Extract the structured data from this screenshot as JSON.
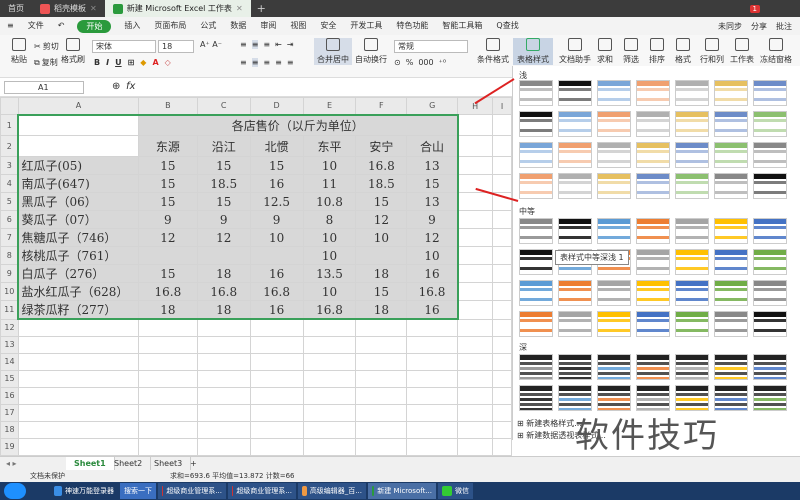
{
  "tabs": {
    "home": "首页",
    "tab1": "稻壳模板",
    "tab2": "新建 Microsoft Excel 工作表",
    "count": "1"
  },
  "menu": {
    "file": "文件",
    "start": "开始",
    "items": [
      "插入",
      "页面布局",
      "公式",
      "数据",
      "审阅",
      "视图",
      "安全",
      "开发工具",
      "特色功能",
      "智能工具箱"
    ],
    "search": "Q查找",
    "sync": "未同步",
    "share": "分享",
    "annotate": "批注"
  },
  "toolbar": {
    "paste": "粘贴",
    "cut": "剪切",
    "copy": "复制",
    "format_painter": "格式刷",
    "font": "宋体",
    "size": "18",
    "merge": "合并居中",
    "wrap": "自动换行",
    "numfmt": "常规",
    "cond": "条件格式",
    "table_style": "表格样式",
    "doc_helper": "文档助手",
    "sum": "求和",
    "filter": "筛选",
    "sort": "排序",
    "format": "格式",
    "rowcol": "行和列",
    "sheet": "工作表",
    "freeze": "冻结窗格"
  },
  "formula": {
    "cell": "A1",
    "fx": "fx"
  },
  "columns": [
    "A",
    "B",
    "C",
    "D",
    "E",
    "F",
    "G",
    "H",
    "I"
  ],
  "sheet": {
    "title": "各店售价（以斤为单位）",
    "stores": [
      "东源",
      "沿江",
      "北惯",
      "东平",
      "安宁",
      "合山"
    ],
    "rows": [
      {
        "name": "红瓜子(05)",
        "v": [
          "15",
          "15",
          "15",
          "10",
          "16.8",
          "13"
        ]
      },
      {
        "name": "南瓜子(647)",
        "v": [
          "15",
          "18.5",
          "16",
          "11",
          "18.5",
          "15"
        ]
      },
      {
        "name": "黑瓜子（06）",
        "v": [
          "15",
          "15",
          "12.5",
          "10.8",
          "15",
          "13"
        ]
      },
      {
        "name": "葵瓜子（07）",
        "v": [
          "9",
          "9",
          "9",
          "8",
          "12",
          "9"
        ]
      },
      {
        "name": "焦糖瓜子（746）",
        "v": [
          "12",
          "12",
          "10",
          "10",
          "10",
          "12"
        ]
      },
      {
        "name": "核桃瓜子（761）",
        "v": [
          "",
          "",
          "",
          "10",
          "",
          "10"
        ]
      },
      {
        "name": "白瓜子（276）",
        "v": [
          "15",
          "18",
          "16",
          "13.5",
          "18",
          "16"
        ]
      },
      {
        "name": "盐水红瓜子（628）",
        "v": [
          "16.8",
          "16.8",
          "16.8",
          "10",
          "15",
          "16.8"
        ]
      },
      {
        "name": "绿茶瓜籽（277）",
        "v": [
          "18",
          "18",
          "16",
          "16.8",
          "18",
          "16"
        ]
      }
    ]
  },
  "panel": {
    "light": "浅",
    "medium": "中等",
    "dark": "深",
    "tooltip": "表样式中等深浅 1",
    "new_table_style": "新建表格样式...",
    "new_data_style": "新建数据透视表样式..."
  },
  "sheets": [
    "Sheet1",
    "Sheet2",
    "Sheet3"
  ],
  "status": {
    "protect": "文档未保护",
    "stats": "求和=693.6  平均值=13.872  计数=66"
  },
  "taskbar": [
    "神速万能登录器",
    "搜索一下",
    "超级商业管理系...",
    "超级商业管理系...",
    "高级编辑器_百...",
    "新建 Microsoft...",
    "微信"
  ],
  "watermark": "软件技巧"
}
